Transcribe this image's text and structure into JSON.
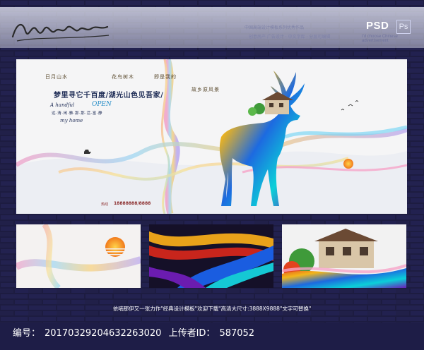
{
  "header": {
    "signature_text": "Design",
    "format_label": "PSD",
    "app_badge": "Ps",
    "tagline_en": "I'd choose Chinese advertisement",
    "line_1": "中国高端设计模板系列优秀作品",
    "line_2": "创意房产 广告设计 · 中文字库 · 分层可编辑"
  },
  "poster": {
    "tags": [
      "日月山水",
      "花鸟树木",
      "即是我的",
      "故乡原风景"
    ],
    "headline": "梦里寻它千百度/湖光山色见吾家/",
    "en_line_1": "A handful",
    "en_line_2": "OPEN",
    "sub_line": "远·清·闲·雅·那·那·活·富·静",
    "en_line_3": "my home",
    "phone_label": "热线",
    "phone": "18888888/8888"
  },
  "thumbnails": [
    {
      "name": "detail-sunset"
    },
    {
      "name": "detail-stripes"
    },
    {
      "name": "detail-villa"
    }
  ],
  "footer": {
    "description": "依喃那伊又一张力作\"经典设计模板\"欢迎下载\"高清大尺寸:3888X9888\"文字可替换\"",
    "id_label": "编号：",
    "id_value": "20170329204632263020",
    "uploader_label": "上传者ID：",
    "uploader_value": "587052"
  },
  "colors": {
    "background": "#1b1a3c",
    "panel": "#f4f4f4",
    "accent_blue": "#2a8fc8",
    "title_navy": "#1d2b55"
  }
}
